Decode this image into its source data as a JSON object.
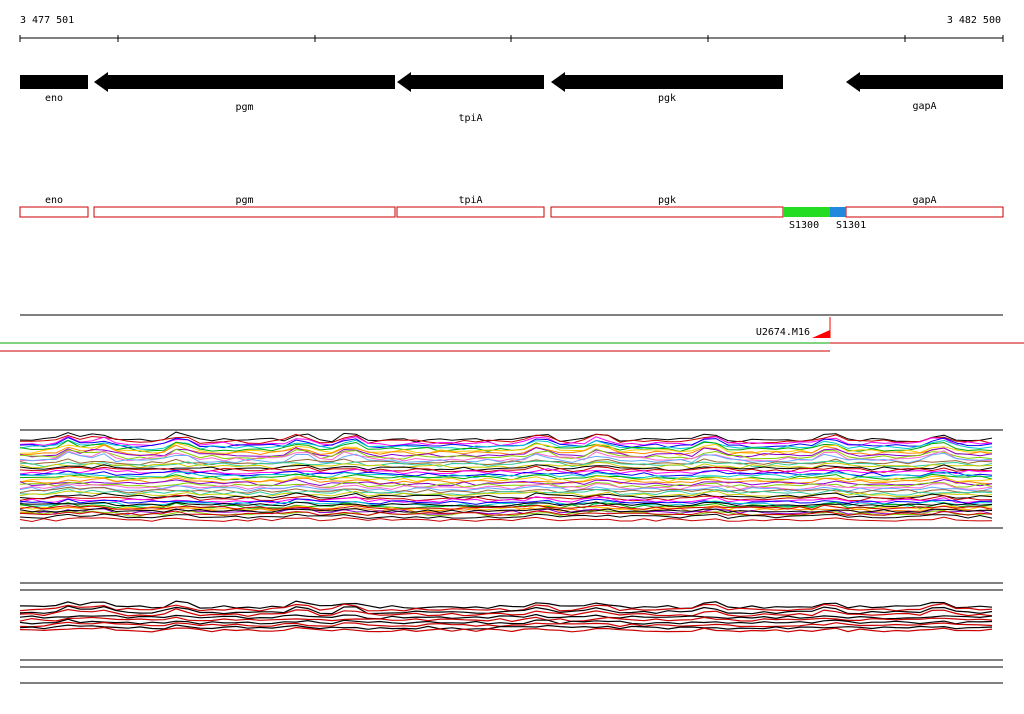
{
  "coordinates": {
    "start": "3 477 501",
    "end": "3 482 500"
  },
  "genes": [
    {
      "name": "eno",
      "start": 20,
      "end": 88,
      "strand": "+"
    },
    {
      "name": "pgm",
      "start": 94,
      "end": 395,
      "strand": "-"
    },
    {
      "name": "tpiA",
      "start": 397,
      "end": 544,
      "strand": "-"
    },
    {
      "name": "pgk",
      "start": 551,
      "end": 783,
      "strand": "-"
    },
    {
      "name": "gapA",
      "start": 846,
      "end": 1003,
      "strand": "-"
    }
  ],
  "features": [
    {
      "name": "S1300",
      "start": 783,
      "end": 830,
      "color": "#22dd22"
    },
    {
      "name": "S1301",
      "start": 830,
      "end": 846,
      "color": "#2288dd"
    }
  ],
  "promoter": {
    "name": "U2674.M16",
    "position": 830,
    "color": "#ff0000"
  },
  "colors": {
    "gene_arrow": "#000000",
    "gene_box": "#cc0000",
    "green_line": "#00aa00",
    "red_line": "#cc0000",
    "track_line": "#000000"
  },
  "track_palette": [
    "#000000",
    "#cc0000",
    "#ff00ff",
    "#0000ff",
    "#00cccc",
    "#00aa00",
    "#ffcc00",
    "#ff8800",
    "#8800cc",
    "#88cc00",
    "#ff66cc",
    "#66aaff",
    "#996633",
    "#33cc99",
    "#cccc00"
  ]
}
